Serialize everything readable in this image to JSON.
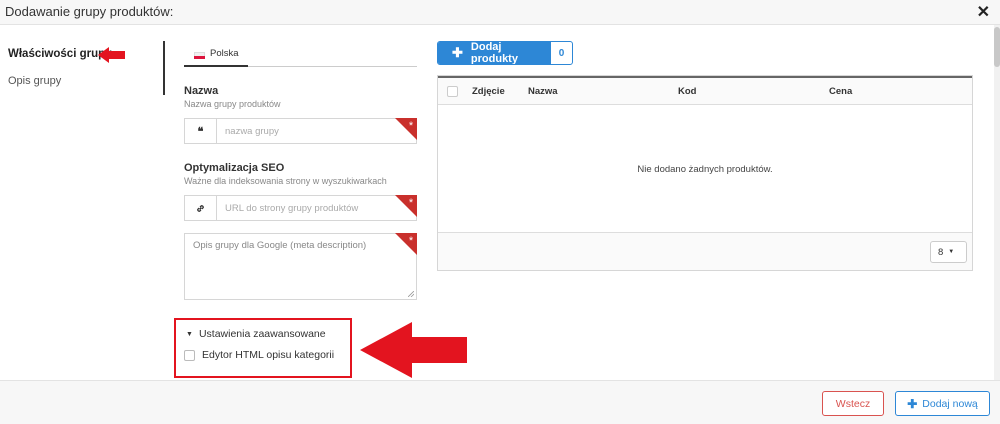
{
  "header": {
    "title": "Dodawanie grupy produktów:",
    "close_icon": "close-icon"
  },
  "left_nav": {
    "items": [
      {
        "label": "Właściwości grupy",
        "active": true
      },
      {
        "label": "Opis grupy",
        "active": false
      }
    ]
  },
  "language_tab": {
    "label": "Polska",
    "flag_icon": "poland-flag-icon"
  },
  "name_field": {
    "label": "Nazwa",
    "help": "Nazwa grupy produktów",
    "icon": "quote-icon",
    "placeholder": "nazwa grupy",
    "value": ""
  },
  "seo": {
    "label": "Optymalizacja SEO",
    "help": "Ważne dla indeksowania strony w wyszukiwarkach",
    "url_icon": "link-icon",
    "url_placeholder": "URL do strony grupy produktów",
    "meta_placeholder": "Opis grupy dla Google (meta description)"
  },
  "advanced": {
    "toggle_label": "Ustawienia zaawansowane",
    "html_editor_label": "Edytor HTML opisu kategorii",
    "html_editor_checked": false
  },
  "products": {
    "add_button_label": "Dodaj produkty",
    "count": "0",
    "columns": [
      "Zdjęcie",
      "Nazwa",
      "Kod",
      "Cena"
    ],
    "empty_message": "Nie dodano żadnych produktów.",
    "page_size": "8"
  },
  "footer": {
    "back_label": "Wstecz",
    "add_new_label": "Dodaj nową"
  },
  "colors": {
    "primary": "#2d87d6",
    "danger": "#d9534f",
    "annotation_red": "#e3141f"
  }
}
